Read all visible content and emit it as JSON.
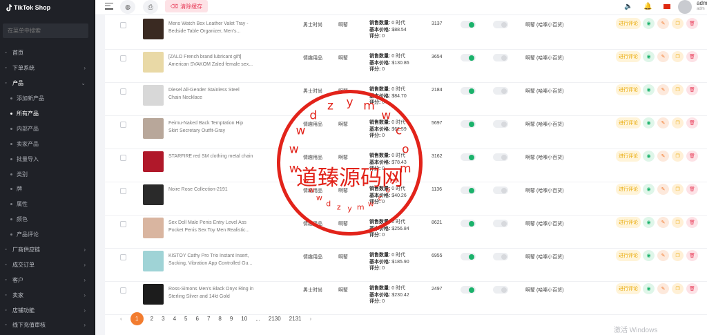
{
  "app": {
    "logo_text": "TikTok Shop"
  },
  "sidebar": {
    "search_placeholder": "在菜单中搜索",
    "items": [
      {
        "label": "首页",
        "icon": "home-icon",
        "type": "top"
      },
      {
        "label": "下单系统",
        "icon": "order-icon",
        "type": "top",
        "chevron": "›"
      },
      {
        "label": "产品",
        "icon": "product-icon",
        "type": "top-open",
        "chevron": "⌄"
      },
      {
        "label": "添加新产品",
        "type": "sub"
      },
      {
        "label": "所有产品",
        "type": "sub-current"
      },
      {
        "label": "内部产品",
        "type": "sub"
      },
      {
        "label": "卖家产品",
        "type": "sub"
      },
      {
        "label": "批量导入",
        "type": "sub"
      },
      {
        "label": "类别",
        "type": "sub"
      },
      {
        "label": "牌",
        "type": "sub"
      },
      {
        "label": "属性",
        "type": "sub"
      },
      {
        "label": "颜色",
        "type": "sub"
      },
      {
        "label": "产品评论",
        "type": "sub"
      },
      {
        "label": "厂商供应链",
        "icon": "supply-icon",
        "type": "top",
        "chevron": "›"
      },
      {
        "label": "成交订单",
        "icon": "deal-icon",
        "type": "top",
        "chevron": "›"
      },
      {
        "label": "客户",
        "icon": "customer-icon",
        "type": "top",
        "chevron": "›"
      },
      {
        "label": "卖家",
        "icon": "seller-icon",
        "type": "top",
        "chevron": "›"
      },
      {
        "label": "店铺功能",
        "icon": "store-icon",
        "type": "top",
        "chevron": "›"
      },
      {
        "label": "线下充值审核",
        "icon": "recharge-icon",
        "type": "top",
        "chevron": "›"
      }
    ]
  },
  "topbar": {
    "clear_cache_label": "清除缓存",
    "user_name": "adm",
    "user_role": "adm"
  },
  "table": {
    "review_label": "进行评论",
    "stat_labels": {
      "sales": "销售数量:",
      "base_price": "基本价格:",
      "rating": "评分:"
    },
    "rows": [
      {
        "name": [
          "Mens Watch Box Leather Valet Tray -",
          "Bedside Table Organizer, Men's..."
        ],
        "category": "男士时尚",
        "brand": "啊鼕",
        "sales": "0 时代",
        "price": "$88.54",
        "rating": "0",
        "code": "3137",
        "published": true,
        "featured": false,
        "shop": "啊鼕 (哈嗪小百货)",
        "thumb_color": "#3a2a22"
      },
      {
        "name": [
          "[ZALO French brand lubricant gift]",
          "American SVAKOM Zaled female sex..."
        ],
        "category": "情趣用品",
        "brand": "啊鼕",
        "sales": "0 时代",
        "price": "$130.86",
        "rating": "0",
        "code": "3654",
        "published": true,
        "featured": false,
        "shop": "啊鼕 (哈嗪小百货)",
        "thumb_color": "#e9d9a6"
      },
      {
        "name": [
          "Diesel All-Gender Stainless Steel",
          "Chain Necklace"
        ],
        "category": "男士时尚",
        "brand": "啊鼕",
        "sales": "0 时代",
        "price": "$84.70",
        "rating": "0",
        "code": "2184",
        "published": true,
        "featured": false,
        "shop": "啊鼕 (哈嗪小百货)",
        "thumb_color": "#d8d8d8"
      },
      {
        "name": [
          "Feimu-Naked Back Temptation Hip",
          "Skirt Secretary Outfit-Gray"
        ],
        "category": "情趣用品",
        "brand": "啊鼕",
        "sales": "0 时代",
        "price": "$62.59",
        "rating": "0",
        "code": "5697",
        "published": true,
        "featured": false,
        "shop": "啊鼕 (哈嗪小百货)",
        "thumb_color": "#b8a79a"
      },
      {
        "name": [
          "STARFIRE red SM clothing metal chain",
          ""
        ],
        "category": "情趣用品",
        "brand": "啊鼕",
        "sales": "0 时代",
        "price": "$78.43",
        "rating": "0",
        "code": "3162",
        "published": true,
        "featured": false,
        "shop": "啊鼕 (哈嗪小百货)",
        "thumb_color": "#b0182a"
      },
      {
        "name": [
          "Noire Rose Collection-2191",
          ""
        ],
        "category": "情趣用品",
        "brand": "啊鼕",
        "sales": "0 时代",
        "price": "$40.26",
        "rating": "0",
        "code": "1136",
        "published": true,
        "featured": false,
        "shop": "啊鼕 (哈嗪小百货)",
        "thumb_color": "#2a2a2a"
      },
      {
        "name": [
          "Sex Doll Male Penis Entry Level Ass",
          "Pocket Penis Sex Toy Men Realistic..."
        ],
        "category": "情趣用品",
        "brand": "啊鼕",
        "sales": "0 时代",
        "price": "$256.84",
        "rating": "0",
        "code": "8621",
        "published": true,
        "featured": false,
        "shop": "啊鼕 (哈嗪小百货)",
        "thumb_color": "#d9b5a0"
      },
      {
        "name": [
          "KISTOY Cathy Pro Trio Instant Insert,",
          "Sucking, Vibration App Controlled Gu..."
        ],
        "category": "情趣用品",
        "brand": "啊鼕",
        "sales": "0 时代",
        "price": "$185.90",
        "rating": "0",
        "code": "6955",
        "published": true,
        "featured": false,
        "shop": "啊鼕 (哈嗪小百货)",
        "thumb_color": "#9fd3d6"
      },
      {
        "name": [
          "Ross-Simons Men's Black Onyx Ring in",
          "Sterling Silver and 14kt Gold"
        ],
        "category": "男士时尚",
        "brand": "啊鼕",
        "sales": "0 时代",
        "price": "$230.42",
        "rating": "0",
        "code": "2497",
        "published": true,
        "featured": false,
        "shop": "啊鼕 (哈嗪小百货)",
        "thumb_color": "#1c1c1c"
      }
    ]
  },
  "pagination": {
    "prev": "‹",
    "current": "1",
    "pages": [
      "2",
      "3",
      "4",
      "5",
      "6",
      "7",
      "8",
      "9",
      "10",
      "...",
      "2130",
      "2131"
    ],
    "next": "›"
  },
  "watermark": {
    "main_text": "道臻源码网",
    "upper_letters": [
      "w",
      "w",
      "w",
      "d",
      "z",
      "y",
      "m",
      "w",
      "c",
      "o",
      "m"
    ],
    "lower_letters": [
      "w",
      "w",
      "w",
      "d",
      "z",
      "y",
      "m",
      "w",
      "c",
      "o",
      "m"
    ],
    "color": "#e2231a"
  },
  "system": {
    "activate_windows": "激活 Windows"
  },
  "colors": {
    "accent": "#f27c2f",
    "sidebar_bg": "#1f2127",
    "toggle_on": "#1bb26b"
  }
}
